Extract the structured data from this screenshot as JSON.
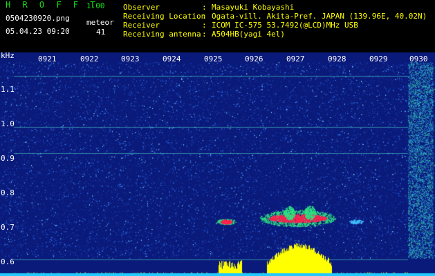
{
  "app": {
    "title": "H R O F F T",
    "version": "1.00",
    "file_name": "0504230920.png",
    "datetime": "05.04.23 09:20",
    "detection_label": "meteor",
    "detection_count": "41"
  },
  "info": {
    "rows": [
      {
        "key": "Observer",
        "value": "Masayuki Kobayashi"
      },
      {
        "key": "Receiving Location",
        "value": "Ogata-vill. Akita-Pref. JAPAN (139.96E, 40.02N)"
      },
      {
        "key": "Receiver",
        "value": "ICOM IC-575 53.7492(@LCD)MHz USB"
      },
      {
        "key": "Receiving antenna",
        "value": "A504HB(yagi 4el)"
      }
    ]
  },
  "spectrogram": {
    "freq_unit": "kHz",
    "freq_ticks": [
      "1.1",
      "1.0",
      "0.9",
      "0.8",
      "0.7",
      "0.6"
    ],
    "time_ticks": [
      "0921",
      "0922",
      "0923",
      "0924",
      "0925",
      "0926",
      "0927",
      "0928",
      "0929",
      "0930"
    ],
    "colors": {
      "background": "#0a1a7a",
      "noise": "#2a6adf",
      "echo_core": "#ff2050",
      "echo_halo": "#30e080",
      "power": "#ffff00",
      "baseline": "#22c8ff"
    }
  }
}
